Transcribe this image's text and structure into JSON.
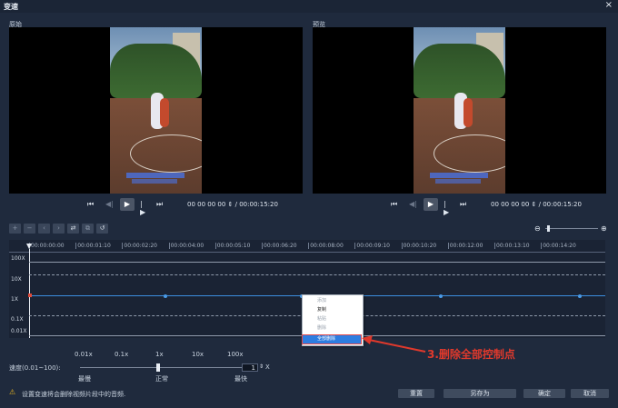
{
  "window": {
    "title": "变速",
    "close_glyph": "×"
  },
  "panels": {
    "original_label": "原始",
    "preview_label": "预览"
  },
  "player_left": {
    "timecode_fields": "00 00 00 00",
    "duration": "/ 00:00:15:20"
  },
  "player_right": {
    "timecode_fields": "00 00 00 00",
    "duration": "/ 00:00:15:20"
  },
  "ruler": {
    "ticks": [
      "00:00:00:00",
      "00:00:01:10",
      "00:00:02:20",
      "00:00:04:00",
      "00:00:05:10",
      "00:00:06:20",
      "00:00:08:00",
      "00:00:09:10",
      "00:00:10:20",
      "00:00:12:00",
      "00:00:13:10",
      "00:00:14:20"
    ]
  },
  "speed_axis": {
    "labels": [
      "100X",
      "10X",
      "1X",
      "0.1X",
      "0.01X"
    ]
  },
  "context_menu": {
    "items": [
      {
        "label": "添加",
        "enabled": false
      },
      {
        "label": "复制",
        "enabled": true
      },
      {
        "label": "粘贴",
        "enabled": false
      },
      {
        "label": "删除",
        "enabled": false
      },
      {
        "label": "全部删除",
        "enabled": true,
        "highlighted": true
      }
    ]
  },
  "annotation": {
    "text": "3.删除全部控制点",
    "color": "#e0392c"
  },
  "speed_control": {
    "label": "速度(0.01~100):",
    "scale_marks": [
      "0.01x",
      "0.1x",
      "1x",
      "10x",
      "100x"
    ],
    "min_label": "最慢",
    "normal_label": "正常",
    "max_label": "最快",
    "value": "1",
    "unit": "X"
  },
  "footer": {
    "warning": "设置变速将会删除视频片段中的音频.",
    "reset": "重置",
    "save_as": "另存为",
    "ok": "确定",
    "cancel": "取消"
  },
  "colors": {
    "accent": "#4a9be8",
    "highlight": "#2e7de0",
    "annotation": "#e0392c"
  }
}
